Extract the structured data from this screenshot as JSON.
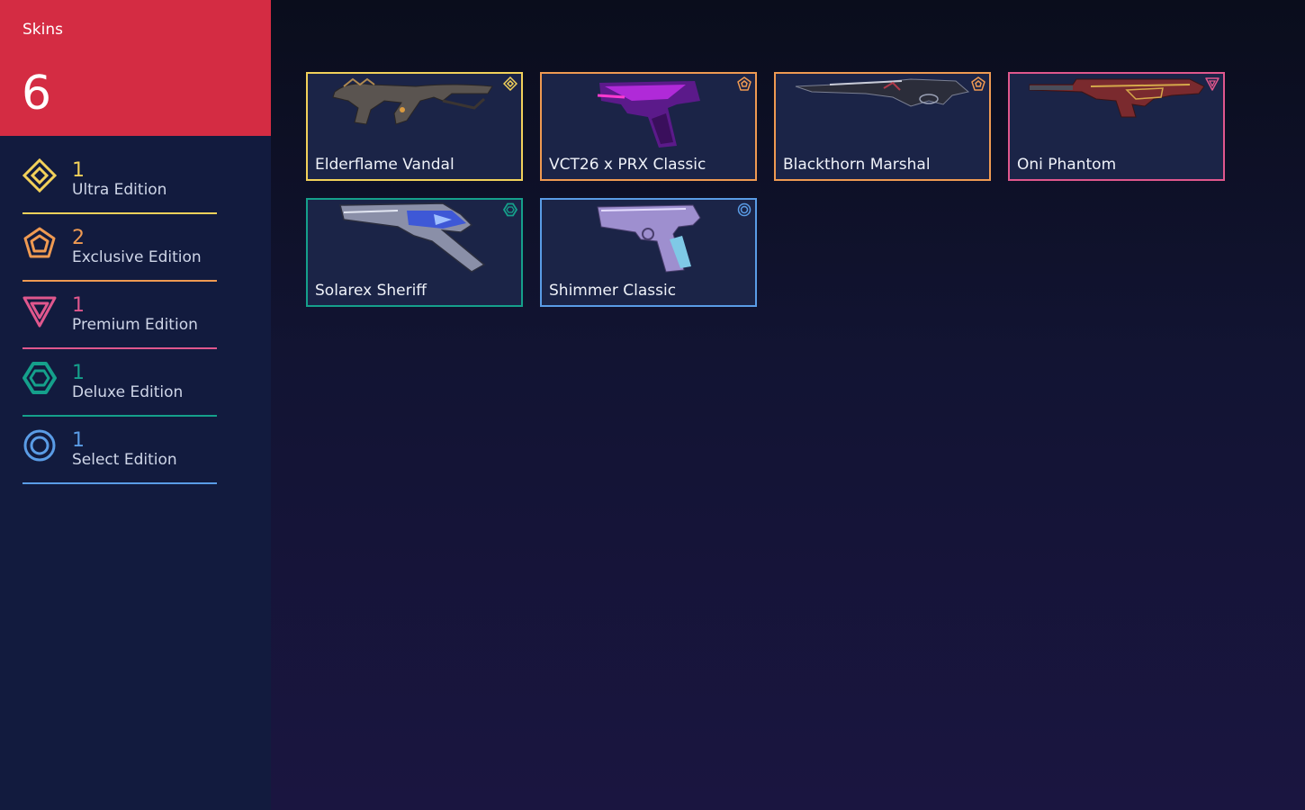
{
  "header": {
    "title": "Skins",
    "count": "6",
    "color": "#d42c43"
  },
  "tiers": [
    {
      "count": "1",
      "label": "Ultra Edition",
      "color": "#f2d15a",
      "icon": "ultra-edition-icon"
    },
    {
      "count": "2",
      "label": "Exclusive Edition",
      "color": "#ef9a52",
      "icon": "exclusive-edition-icon"
    },
    {
      "count": "1",
      "label": "Premium Edition",
      "color": "#e0578d",
      "icon": "premium-edition-icon"
    },
    {
      "count": "1",
      "label": "Deluxe Edition",
      "color": "#15a08b",
      "icon": "deluxe-edition-icon"
    },
    {
      "count": "1",
      "label": "Select Edition",
      "color": "#5a9ce6",
      "icon": "select-edition-icon"
    }
  ],
  "skins": [
    {
      "name": "Elderflame Vandal",
      "tier": "Ultra Edition",
      "color": "#f2d15a",
      "art": "elderflame-vandal-image"
    },
    {
      "name": "VCT26 x PRX Classic",
      "tier": "Exclusive Edition",
      "color": "#ef9a52",
      "art": "vct26-prx-classic-image"
    },
    {
      "name": "Blackthorn Marshal",
      "tier": "Exclusive Edition",
      "color": "#ef9a52",
      "art": "blackthorn-marshal-image"
    },
    {
      "name": "Oni Phantom",
      "tier": "Premium Edition",
      "color": "#e0578d",
      "art": "oni-phantom-image"
    },
    {
      "name": "Solarex Sheriff",
      "tier": "Deluxe Edition",
      "color": "#15a08b",
      "art": "solarex-sheriff-image"
    },
    {
      "name": "Shimmer Classic",
      "tier": "Select Edition",
      "color": "#5a9ce6",
      "art": "shimmer-classic-image"
    }
  ]
}
